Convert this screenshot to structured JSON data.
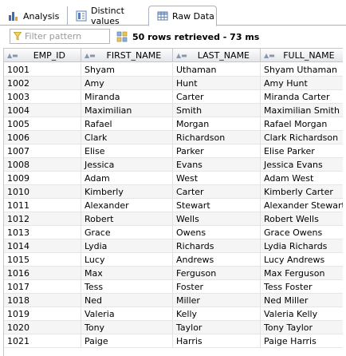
{
  "tabs": [
    {
      "label": "Analysis",
      "icon": "bar-chart-icon",
      "active": false
    },
    {
      "label": "Distinct values",
      "icon": "distinct-values-icon",
      "active": false
    },
    {
      "label": "Raw Data",
      "icon": "grid-table-icon",
      "active": true
    }
  ],
  "filter": {
    "placeholder": "Filter pattern",
    "value": ""
  },
  "status": "50 rows retrieved - 73 ms",
  "table": {
    "columns": [
      "EMP_ID",
      "FIRST_NAME",
      "LAST_NAME",
      "FULL_NAME"
    ],
    "rows": [
      [
        "1001",
        "Shyam",
        "Uthaman",
        "Shyam Uthaman"
      ],
      [
        "1002",
        "Amy",
        "Hunt",
        "Amy Hunt"
      ],
      [
        "1003",
        "Miranda",
        "Carter",
        "Miranda Carter"
      ],
      [
        "1004",
        "Maximilian",
        "Smith",
        "Maximilian Smith"
      ],
      [
        "1005",
        "Rafael",
        "Morgan",
        "Rafael Morgan"
      ],
      [
        "1006",
        "Clark",
        "Richardson",
        "Clark Richardson"
      ],
      [
        "1007",
        "Elise",
        "Parker",
        "Elise Parker"
      ],
      [
        "1008",
        "Jessica",
        "Evans",
        "Jessica Evans"
      ],
      [
        "1009",
        "Adam",
        "West",
        "Adam West"
      ],
      [
        "1010",
        "Kimberly",
        "Carter",
        "Kimberly Carter"
      ],
      [
        "1011",
        "Alexander",
        "Stewart",
        "Alexander Stewart"
      ],
      [
        "1012",
        "Robert",
        "Wells",
        "Robert Wells"
      ],
      [
        "1013",
        "Grace",
        "Owens",
        "Grace Owens"
      ],
      [
        "1014",
        "Lydia",
        "Richards",
        "Lydia Richards"
      ],
      [
        "1015",
        "Lucy",
        "Andrews",
        "Lucy Andrews"
      ],
      [
        "1016",
        "Max",
        "Ferguson",
        "Max Ferguson"
      ],
      [
        "1017",
        "Tess",
        "Foster",
        "Tess Foster"
      ],
      [
        "1018",
        "Ned",
        "Miller",
        "Ned Miller"
      ],
      [
        "1019",
        "Valeria",
        "Kelly",
        "Valeria Kelly"
      ],
      [
        "1020",
        "Tony",
        "Taylor",
        "Tony Taylor"
      ],
      [
        "1021",
        "Paige",
        "Harris",
        "Paige Harris"
      ]
    ]
  },
  "colors": {
    "accent": "#3b6cb7",
    "header_bg": "#e3e6ea",
    "alt_row": "#f5f5f5"
  }
}
